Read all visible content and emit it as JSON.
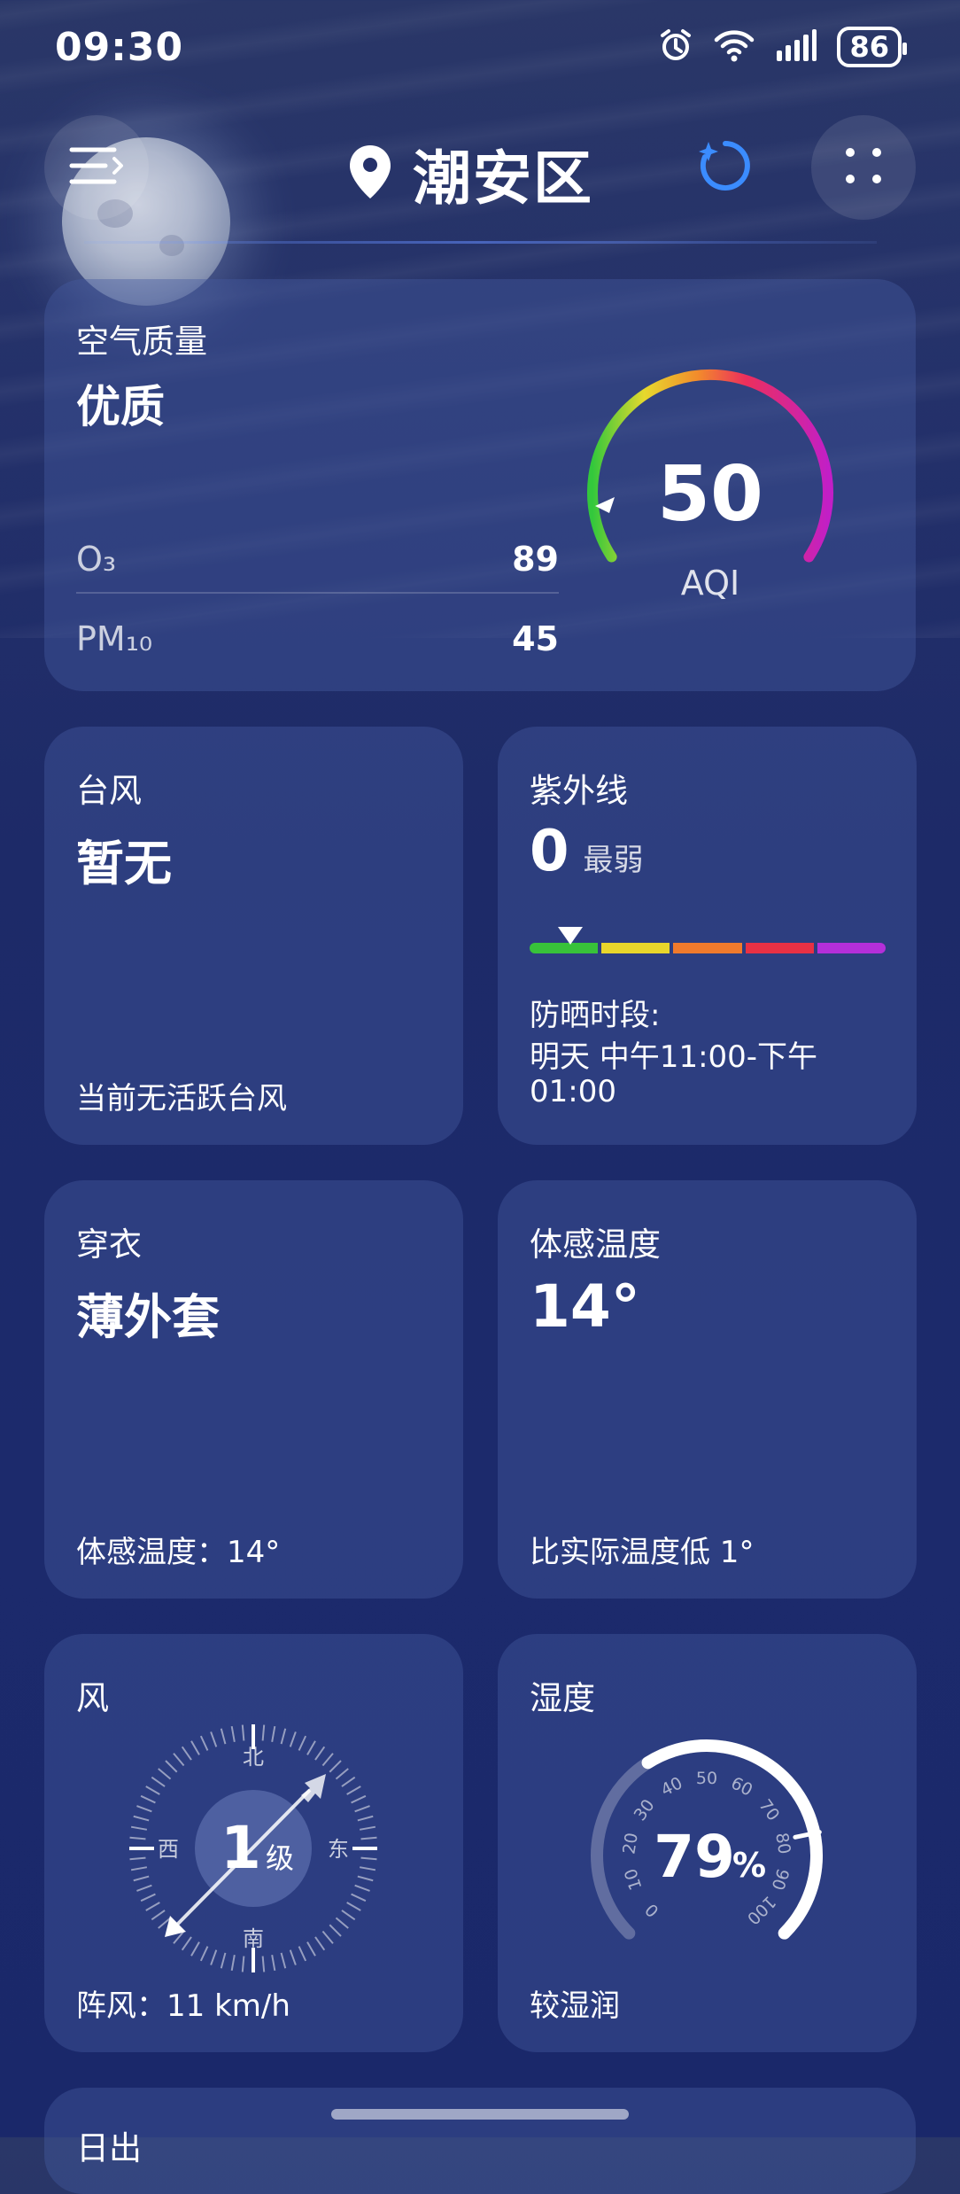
{
  "status_bar": {
    "time": "09:30",
    "battery": "86",
    "icons": [
      "alarm-icon",
      "wifi-icon",
      "signal-icon",
      "battery-icon"
    ]
  },
  "header": {
    "location": "潮安区",
    "icons": [
      "menu-icon",
      "location-pin-icon",
      "refresh-sparkle-icon",
      "more-dots-icon"
    ],
    "accent": "#3b8cff"
  },
  "air_quality": {
    "title": "空气质量",
    "level": "优质",
    "o3_label": "O₃",
    "o3_value": "89",
    "pm10_label": "PM₁₀",
    "pm10_value": "45",
    "aqi_value": "50",
    "aqi_label": "AQI",
    "gauge_fraction": 0.1
  },
  "typhoon": {
    "title": "台风",
    "value": "暂无",
    "footer": "当前无活跃台风"
  },
  "uv": {
    "title": "紫外线",
    "value": "0",
    "level": "最弱",
    "bar_colors": [
      "#38c23a",
      "#e8d62b",
      "#f07a2c",
      "#e83144",
      "#b42fd9"
    ],
    "marker_fraction": 0.05,
    "sun_label": "防晒时段:",
    "sun_line1": "明天 中午11:00-下午",
    "sun_line2": "01:00"
  },
  "clothing": {
    "title": "穿衣",
    "value": "薄外套",
    "footer": "体感温度：14°"
  },
  "feels_like": {
    "title": "体感温度",
    "value": "14°",
    "footer": "比实际温度低 1°"
  },
  "wind": {
    "title": "风",
    "level_value": "1",
    "level_unit": "级",
    "dir_n": "北",
    "dir_s": "南",
    "dir_e": "东",
    "dir_w": "西",
    "footer": "阵风：11 km/h"
  },
  "humidity": {
    "title": "湿度",
    "value": "79",
    "unit": "%",
    "ticks": [
      "0",
      "10",
      "20",
      "30",
      "40",
      "50",
      "60",
      "70",
      "80",
      "90",
      "100"
    ],
    "percent": 79,
    "footer": "较湿润"
  },
  "sunrise": {
    "title": "日出"
  }
}
